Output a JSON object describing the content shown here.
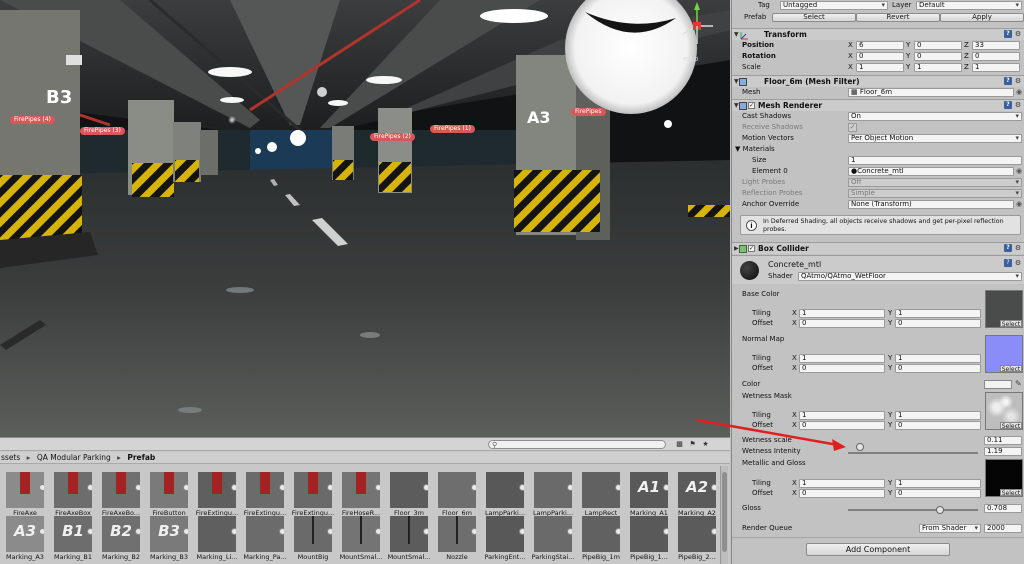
{
  "scene": {
    "persp_label": "ersp",
    "pillar_labels": [
      "B3",
      "A3"
    ],
    "fire_pipes": [
      "FirePipes (4)",
      "FirePipes (3)",
      "FirePipes (2)",
      "FirePipes (1)",
      "FirePipes"
    ]
  },
  "project": {
    "breadcrumb": [
      "ssets",
      "QA Modular Parking",
      "Prefab"
    ],
    "row1": [
      "FireAxe",
      "FireAxeBox",
      "FireAxeBo...",
      "FireButton",
      "FireExtingu...",
      "FireExtingu...",
      "FireExtingu...",
      "FireHoseR...",
      "Floor_3m",
      "Floor_6m",
      "LampParki...",
      "LampParki...",
      "LampRect",
      "Marking_A1",
      "Marking_A2"
    ],
    "row2": [
      "Marking_A3",
      "Marking_B1",
      "Marking_B2",
      "Marking_B3",
      "Marking_Li...",
      "Marking_Pa...",
      "MountBig",
      "MountSmal...",
      "MountSmal...",
      "Nozzle",
      "ParkingEnt...",
      "ParkingStai...",
      "PipeBig_1m",
      "PipeBig_1...",
      "PipeBig_2..."
    ],
    "row1_glyphs": [
      "",
      "",
      "",
      "",
      "",
      "",
      "",
      "",
      "",
      "",
      "",
      "",
      "",
      "A1",
      "A2"
    ],
    "row2_glyphs": [
      "A3",
      "B1",
      "B2",
      "B3",
      "",
      "",
      "",
      "",
      "",
      "",
      "",
      "",
      "",
      "",
      ""
    ]
  },
  "inspector": {
    "tag_label": "Tag",
    "tag_value": "Untagged",
    "layer_label": "Layer",
    "layer_value": "Default",
    "prefab_label": "Prefab",
    "select_btn": "Select",
    "revert_btn": "Revert",
    "apply_btn": "Apply",
    "transform": {
      "title": "Transform",
      "position_label": "Position",
      "rotation_label": "Rotation",
      "scale_label": "Scale",
      "x": "X",
      "y": "Y",
      "z": "Z",
      "position": [
        "6",
        "0",
        "33"
      ],
      "rotation": [
        "0",
        "0",
        "0"
      ],
      "scale": [
        "1",
        "1",
        "1"
      ]
    },
    "mesh_filter": {
      "title": "Floor_6m (Mesh Filter)",
      "mesh_label": "Mesh",
      "mesh_value": "Floor_6m"
    },
    "mesh_renderer": {
      "title": "Mesh Renderer",
      "cast_shadows_label": "Cast Shadows",
      "cast_shadows": "On",
      "receive_shadows_label": "Receive Shadows",
      "motion_vectors_label": "Motion Vectors",
      "motion_vectors": "Per Object Motion",
      "materials_label": "Materials",
      "size_label": "Size",
      "size": "1",
      "element0_label": "Element 0",
      "element0": "Concrete_mtl",
      "light_probes_label": "Light Probes",
      "light_probes": "Off",
      "reflection_probes_label": "Reflection Probes",
      "reflection_probes": "Simple",
      "anchor_override_label": "Anchor Override",
      "anchor_override": "None (Transform)",
      "info": "In Deferred Shading, all objects receive shadows and get per-pixel reflection probes."
    },
    "box_collider": {
      "title": "Box Collider"
    },
    "material": {
      "name": "Concrete_mtl",
      "shader_label": "Shader",
      "shader_value": "QAtmo/QAtmo_WetFloor",
      "base_color_label": "Base Color",
      "normal_map_label": "Normal Map",
      "color_label": "Color",
      "wetness_mask_label": "Wetness Mask",
      "tiling_label": "Tiling",
      "offset_label": "Offset",
      "tiling_x": "1",
      "tiling_y": "1",
      "offset_x": "0",
      "offset_y": "0",
      "x": "X",
      "y": "Y",
      "wetness_scale_label": "Wetness scale",
      "wetness_scale": "0.11",
      "wetness_intensity_label": "Wetness Intenity",
      "wetness_intensity": "1.19",
      "metallic_gloss_label": "Metallic and Gloss",
      "gloss_label": "Gloss",
      "gloss": "0.708",
      "render_queue_label": "Render Queue",
      "render_queue_mode": "From Shader",
      "render_queue": "2000",
      "select_label": "Select"
    },
    "add_component": "Add Component"
  },
  "colors": {
    "firepipe_bg": "#d8585a",
    "accent_arrow": "#e02020",
    "normal_map": "#8a8cf7"
  }
}
